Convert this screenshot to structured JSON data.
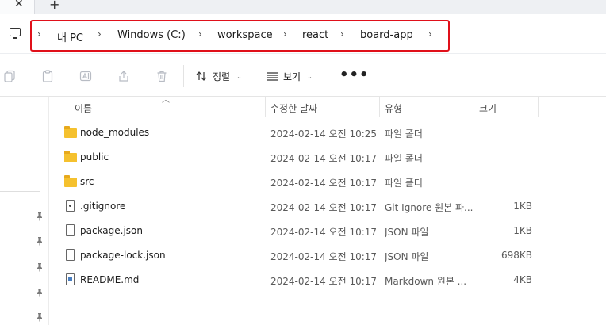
{
  "tabbar": {
    "close_glyph": "✕",
    "new_tab_glyph": "+"
  },
  "address": {
    "crumbs": [
      "내 PC",
      "Windows (C:)",
      "workspace",
      "react",
      "board-app"
    ],
    "separator": "›"
  },
  "toolbar": {
    "sort_label": "정렬",
    "view_label": "보기",
    "more_label": "•••"
  },
  "columns": {
    "name": "이름",
    "modified": "수정한 날짜",
    "type": "유형",
    "size": "크기"
  },
  "files": [
    {
      "name": "node_modules",
      "modified": "2024-02-14 오전 10:25",
      "type": "파일 폴더",
      "size": "",
      "icon": "folder-icon"
    },
    {
      "name": "public",
      "modified": "2024-02-14 오전 10:17",
      "type": "파일 폴더",
      "size": "",
      "icon": "folder-icon"
    },
    {
      "name": "src",
      "modified": "2024-02-14 오전 10:17",
      "type": "파일 폴더",
      "size": "",
      "icon": "folder-icon"
    },
    {
      "name": ".gitignore",
      "modified": "2024-02-14 오전 10:17",
      "type": "Git Ignore 원본 파...",
      "size": "1KB",
      "icon": "gitignore-file-icon"
    },
    {
      "name": "package.json",
      "modified": "2024-02-14 오전 10:17",
      "type": "JSON 파일",
      "size": "1KB",
      "icon": "json-file-icon"
    },
    {
      "name": "package-lock.json",
      "modified": "2024-02-14 오전 10:17",
      "type": "JSON 파일",
      "size": "698KB",
      "icon": "json-file-icon"
    },
    {
      "name": "README.md",
      "modified": "2024-02-14 오전 10:17",
      "type": "Markdown 원본 ...",
      "size": "4KB",
      "icon": "markdown-file-icon"
    }
  ],
  "colors": {
    "breadcrumb_highlight": "#e0101a",
    "folder": "#f5c12e"
  }
}
